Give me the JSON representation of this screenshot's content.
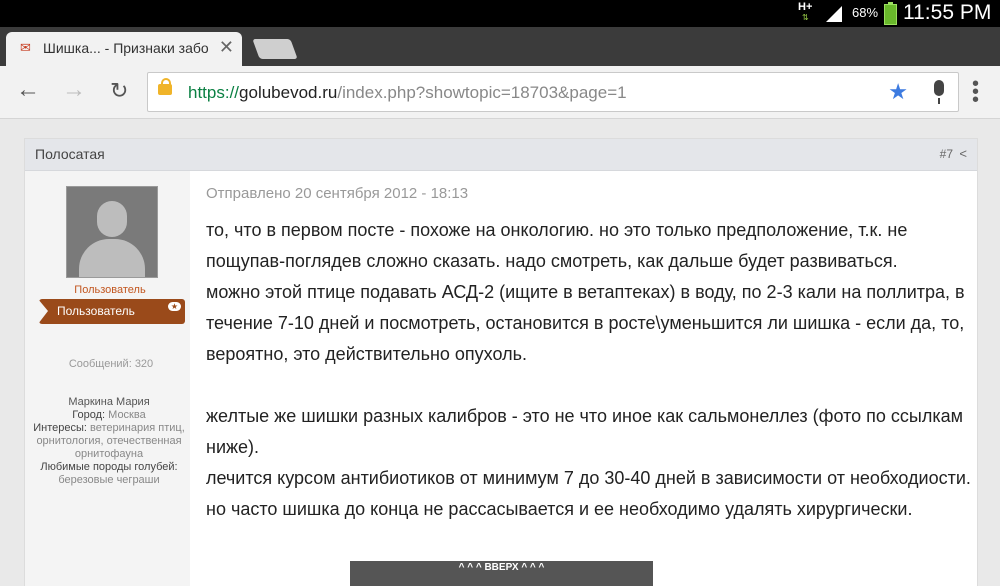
{
  "status_bar": {
    "network": "H+",
    "battery_percent": "68%",
    "time": "11:55 PM",
    "battery_color": "#69b82b"
  },
  "browser": {
    "tab": {
      "title": "Шишка... - Признаки забо",
      "favicon": "pigeon-favicon-icon",
      "close": "✕"
    },
    "url": {
      "scheme": "https://",
      "host": "golubevod.ru",
      "path": "/index.php?showtopic=18703&page=1"
    },
    "icons": {
      "back": "←",
      "forward": "→",
      "reload": "↻",
      "star": "★",
      "menu": "⋮"
    },
    "accent": "#3d7be0"
  },
  "post": {
    "author": "Полосатая",
    "number": "#7",
    "date": "Отправлено 20 сентября 2012 - 18:13",
    "group_label": "Пользователь",
    "group_ribbon": "Пользователь",
    "posts_count": "Сообщений: 320",
    "profile": {
      "name": "Маркина Мария",
      "city_label": "Город:",
      "city": "Москва",
      "interests_label": "Интересы:",
      "interests": "ветеринария птиц, орнитология, отечественная орнитофауна",
      "breeds_label": "Любимые породы голубей:",
      "breeds": "березовые чеграши"
    },
    "paragraphs": [
      "то, что в первом посте - похоже на онкологию. но это только предположение, т.к. не пощупав-поглядев сложно сказать. надо смотреть, как дальше будет развиваться.",
      "можно этой птице подавать АСД-2 (ищите в ветаптеках) в воду, по 2-3 кали на поллитра, в течение 7-10 дней и посмотреть, остановится в росте\\уменьшится ли шишка - если да, то, вероятно, это действительно опухоль.",
      "желтые же шишки разных калибров - это не что иное как сальмонеллез (фото по ссылкам ниже).",
      "лечится курсом антибиотиков от минимум 7 до 30-40 дней в зависимости от необходиости. но часто шишка до конца не рассасывается и ее необходимо удалять хирургически."
    ]
  },
  "scroll_top": "^ ^ ^ ВВЕРХ ^ ^ ^"
}
